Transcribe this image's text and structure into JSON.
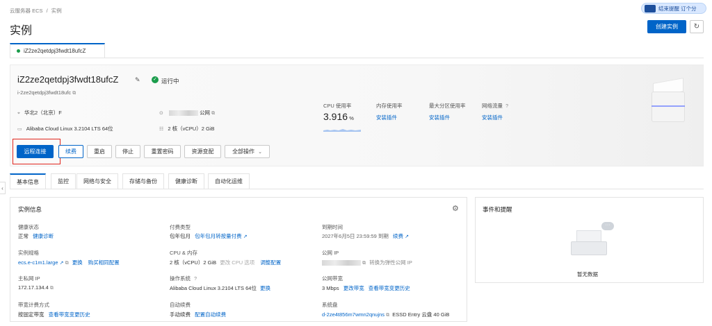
{
  "breadcrumb": {
    "root": "云服务器 ECS",
    "sep": "/",
    "current": "实例"
  },
  "page_title": "实例",
  "top_right": {
    "promo_text": "结束提醒 订个分"
  },
  "actions": {
    "create_label": "创建实例",
    "refresh_icon": "refresh-icon"
  },
  "instance_tab": {
    "label": "iZ2ze2qetdpj3fwdt18ufcZ",
    "status_color": "#1a9c4b"
  },
  "instance": {
    "name": "iZ2ze2qetdpj3fwdt18ufcZ",
    "status": "运行中",
    "id": "i-2ze2qetdpj3fwdt18ufc",
    "region": "华北2（北京）F",
    "public_ip_suffix": "公网",
    "os": "Alibaba Cloud Linux 3.2104 LTS 64位",
    "spec": "2 核（vCPU）2 GiB"
  },
  "metrics": {
    "cpu_label": "CPU 使用率",
    "cpu_value": "3.916",
    "cpu_unit": "%",
    "mem_label": "内存使用率",
    "mem_link": "安装插件",
    "disk_label": "最大分区使用率",
    "disk_link": "安装插件",
    "net_label": "网络流量",
    "net_link": "安装插件"
  },
  "toolbar": {
    "remote": "远程连接",
    "renew": "续费",
    "restart": "重启",
    "stop": "停止",
    "reset_pwd": "重置密码",
    "change_spec": "资源变配",
    "all_ops": "全部操作"
  },
  "tabs": [
    "基本信息",
    "监控",
    "网络与安全",
    "存储与备份",
    "健康诊断",
    "自动化运维"
  ],
  "info": {
    "title": "实例信息",
    "health_label": "健康状态",
    "health_value": "正常",
    "health_link": "健康诊断",
    "pay_label": "付费类型",
    "pay_value": "包年包月",
    "pay_link": "包年包月转按量付费",
    "expire_label": "到期时间",
    "expire_value": "2027年6月5日 23:59:59 到期",
    "expire_link": "续费",
    "spec_label": "实例规格",
    "spec_value": "ecs.e-c1m1.large",
    "spec_link1": "更换",
    "spec_link2": "购买相同配置",
    "cpumem_label": "CPU & 内存",
    "cpumem_value": "2 核（vCPU）2 GiB",
    "cpumem_muted": "更改 CPU 选项",
    "cpumem_link": "调整配置",
    "pubip_label": "公网 IP",
    "pubip_link": "转换为弹性公网 IP",
    "privip_label": "主私网 IP",
    "privip_value": "172.17.134.4",
    "os_label": "操作系统",
    "os_value": "Alibaba Cloud Linux 3.2104 LTS 64位",
    "os_link": "更换",
    "bw_label": "公网带宽",
    "bw_value": "3 Mbps",
    "bw_link1": "更改带宽",
    "bw_link2": "查看带宽变更历史",
    "billing_label": "带宽计费方式",
    "billing_value": "按固定带宽",
    "billing_link": "查看带宽变更历史",
    "autorenew_label": "自动续费",
    "autorenew_value": "手动续费",
    "autorenew_link": "配置自动续费",
    "sysdisk_label": "系统盘",
    "sysdisk_value": "d-2ze4t856m7wmn2qnujns",
    "sysdisk_extra": "ESSD Entry 云盘 40 GiB"
  },
  "events": {
    "title": "事件和提醒",
    "empty": "暂无数据"
  },
  "colors": {
    "primary": "#0064c8",
    "highlight_border": "#e0241b"
  }
}
